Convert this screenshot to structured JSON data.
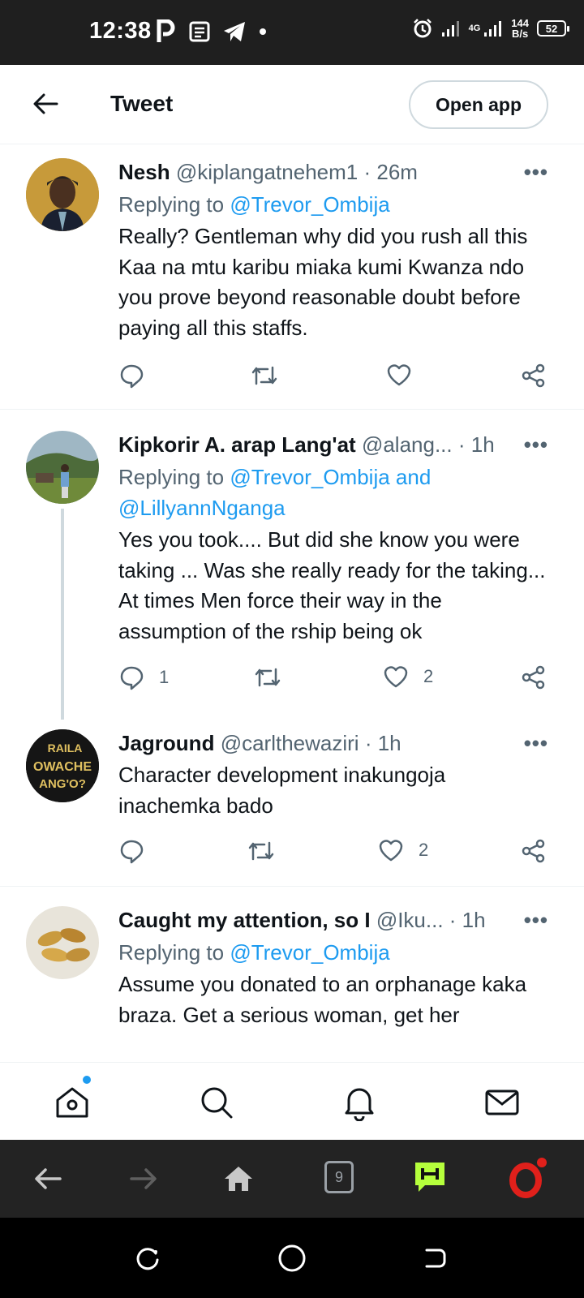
{
  "status_bar": {
    "time": "12:38",
    "network": "4G",
    "speed_value": "144",
    "speed_unit": "B/s",
    "battery": "52"
  },
  "top_bar": {
    "title": "Tweet",
    "open_app_label": "Open app"
  },
  "tweets": [
    {
      "name": "Nesh",
      "handle": "@kiplangatnehem1",
      "time": "· 26m",
      "replying_prefix": "Replying to ",
      "replying_to": "@Trevor_Ombija",
      "text": "Really? Gentleman why did you rush all this Kaa na mtu karibu miaka kumi Kwanza ndo you prove beyond reasonable doubt before paying all this staffs.",
      "replies": "",
      "likes": ""
    },
    {
      "name": "Kipkorir A. arap Lang'at",
      "handle": "@alang...",
      "time": "· 1h",
      "replying_prefix": "Replying to ",
      "replying_to": "@Trevor_Ombija and @LillyannNganga",
      "text": "Yes you took.... But did she know you were taking ... Was she really ready for the taking... At times Men force their way in the assumption of the rship being ok",
      "replies": "1",
      "likes": "2"
    },
    {
      "name": "Jaground",
      "handle": "@carlthewaziri",
      "time": "· 1h",
      "text": "Character development inakungoja inachemka bado",
      "replies": "",
      "likes": "2"
    },
    {
      "name": "Caught my attention, so I",
      "handle": "@Iku...",
      "time": "· 1h",
      "replying_prefix": "Replying to ",
      "replying_to": "@Trevor_Ombija",
      "text": "Assume you donated to an orphanage kaka braza. Get a serious woman, get her"
    }
  ],
  "avatar_text": {
    "jaground_line1": "RAILA",
    "jaground_line2": "OWACHE",
    "jaground_line3": "ANG'O?"
  },
  "browser_bar": {
    "tab_count": "9"
  },
  "colors": {
    "accent": "#1d9bf0",
    "secondary_text": "#536471",
    "status_bar_bg": "#1f1f1f",
    "browser_bar_bg": "#232323",
    "opera_red": "#e0201b",
    "chat_green": "#b5ff3c"
  }
}
